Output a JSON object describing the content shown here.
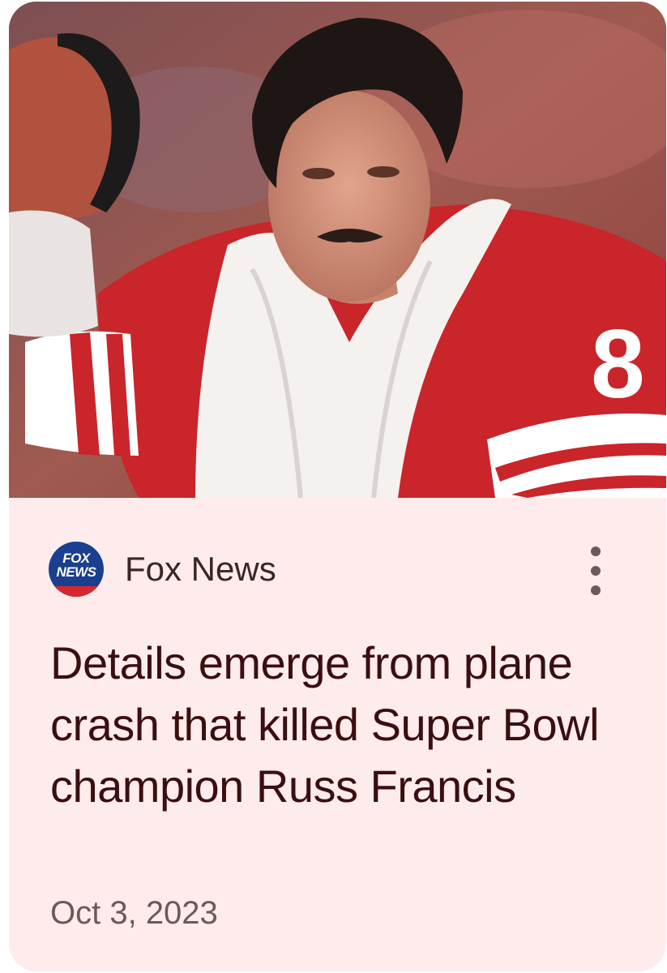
{
  "article": {
    "image_icon": "player-photo",
    "source": {
      "logo_icon": "fox-news-logo-icon",
      "logo_text_line1": "FOX",
      "logo_text_line2": "NEWS",
      "name": "Fox News"
    },
    "menu_icon": "more-vert-icon",
    "headline": "Details emerge from plane crash that killed Super Bowl champion Russ Francis",
    "date": "Oct 3, 2023",
    "jersey_number": "8"
  },
  "colors": {
    "card_background": "#fdeceb",
    "headline": "#3b0e10",
    "date": "#6d5958",
    "jersey_red": "#c9252b"
  }
}
